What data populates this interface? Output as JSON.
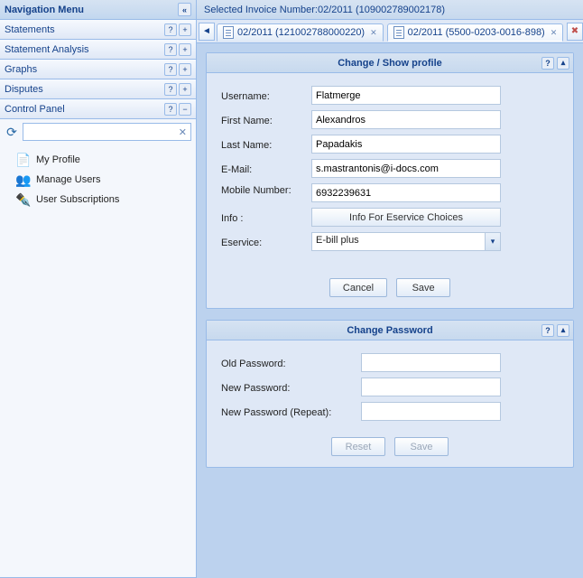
{
  "sidebar": {
    "title": "Navigation Menu",
    "items": [
      {
        "label": "Statements"
      },
      {
        "label": "Statement Analysis"
      },
      {
        "label": "Graphs"
      },
      {
        "label": "Disputes"
      },
      {
        "label": "Control Panel"
      }
    ],
    "tree": [
      {
        "label": "My Profile"
      },
      {
        "label": "Manage Users"
      },
      {
        "label": "User Subscriptions"
      }
    ]
  },
  "top": {
    "selected": "Selected Invoice Number:02/2011 (109002789002178)"
  },
  "tabs": [
    {
      "label": "02/2011 (121002788000220)"
    },
    {
      "label": "02/2011 (5500-0203-0016-898)"
    }
  ],
  "profile": {
    "header": "Change / Show profile",
    "labels": {
      "username": "Username:",
      "first": "First Name:",
      "last": "Last Name:",
      "email": "E-Mail:",
      "mobile": "Mobile Number:",
      "info": "Info :",
      "eservice": "Eservice:"
    },
    "values": {
      "username": "Flatmerge",
      "first": "Alexandros",
      "last": "Papadakis",
      "email": "s.mastrantonis@i-docs.com",
      "mobile": "6932239631"
    },
    "info_button": "Info For Eservice Choices",
    "eservice_value": "E-bill plus",
    "buttons": {
      "cancel": "Cancel",
      "save": "Save"
    }
  },
  "password": {
    "header": "Change Password",
    "labels": {
      "old": "Old Password:",
      "new": "New Password:",
      "repeat": "New Password (Repeat):"
    },
    "buttons": {
      "reset": "Reset",
      "save": "Save"
    }
  }
}
